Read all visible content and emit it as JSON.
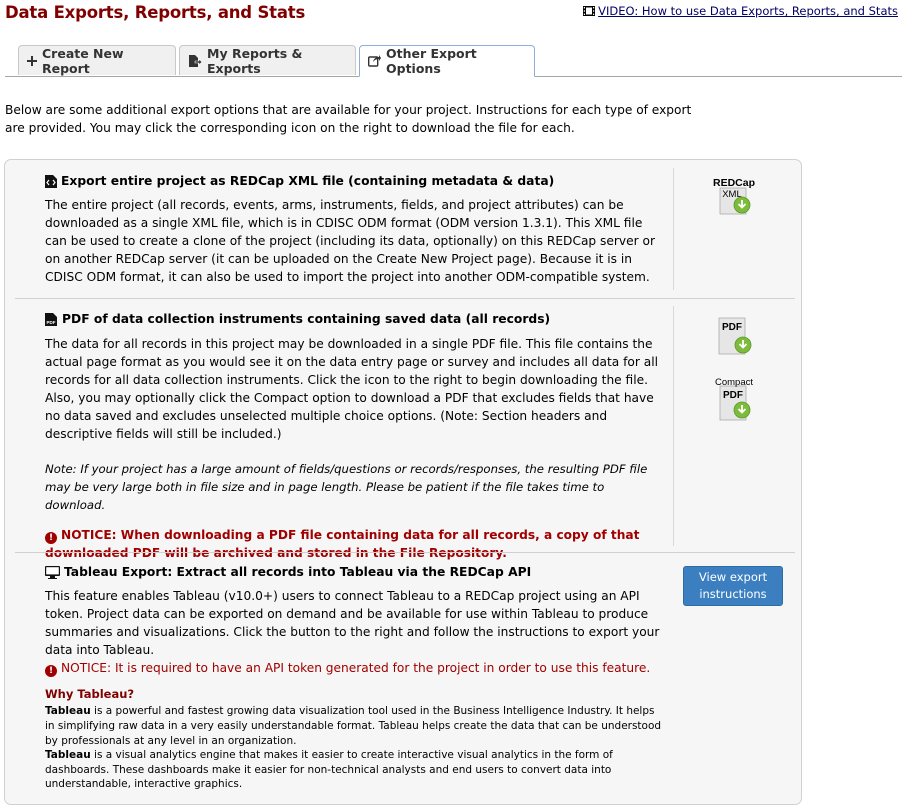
{
  "header": {
    "title": "Data Exports, Reports, and Stats",
    "video_link": "VIDEO: How to use Data Exports, Reports, and Stats"
  },
  "tabs": [
    {
      "label": "Create New Report",
      "icon": "plus-icon"
    },
    {
      "label": "My Reports & Exports",
      "icon": "export-icon"
    },
    {
      "label": "Other Export Options",
      "icon": "share-icon",
      "active": true
    }
  ],
  "intro": {
    "line1": "Below are some additional export options that are available for your project. Instructions for each type of export",
    "line2": "are provided. You may click the corresponding icon on the right to download the file for each."
  },
  "sections": {
    "xml": {
      "title": "Export entire project as REDCap XML file (containing metadata & data)",
      "body": "The entire project (all records, events, arms, instruments, fields, and project attributes) can be downloaded as a single XML file, which is in CDISC ODM format (ODM version 1.3.1). This XML file can be used to create a clone of the project (including its data, optionally) on this REDCap server or on another REDCap server (it can be uploaded on the Create New Project page). Because it is in CDISC ODM format, it can also be used to import the project into another ODM-compatible system.",
      "icon_label_top": "REDCap",
      "icon_label_bottom": "XML"
    },
    "pdf": {
      "title": "PDF of data collection instruments containing saved data (all records)",
      "body": "The data for all records in this project may be downloaded in a single PDF file. This file contains the actual page format as you would see it on the data entry page or survey and includes all data for all records for all data collection instruments. Click the icon to the right to begin downloading the file. Also, you may optionally click the Compact option to download a PDF that excludes fields that have no data saved and excludes unselected multiple choice options. (Note: Section headers and descriptive fields will still be included.)",
      "note": "Note: If your project has a large amount of fields/questions or records/responses, the resulting PDF file may be very large both in file size and in page length. Please be patient if the file takes time to download.",
      "notice": "NOTICE: When downloading a PDF file containing data for all records, a copy of that downloaded PDF will be archived and stored in the File Repository.",
      "icon_pdf_label": "PDF",
      "icon_compact_label": "Compact",
      "icon_compact_pdf_label": "PDF"
    },
    "tableau": {
      "title": "Tableau Export: Extract all records into Tableau via the REDCap API",
      "body": "This feature enables Tableau (v10.0+) users to connect Tableau to a REDCap project using an API token. Project data can be exported on demand and be available for use within Tableau to produce summaries and visualizations. Click the button to the right and follow the instructions to export your data into Tableau.",
      "notice": "NOTICE: It is required to have an API token generated for the project in order to use this feature.",
      "button": "View export instructions",
      "why_title": "Why Tableau?",
      "why_1_bold": "Tableau",
      "why_1_text": " is a powerful and fastest growing data visualization tool used in the Business Intelligence Industry. It helps in simplifying raw data in a very easily understandable format. Tableau helps create the data that can be understood by professionals at any level in an organization.",
      "why_2_bold": "Tableau",
      "why_2_text": " is a visual analytics engine that makes it easier to create interactive visual analytics in the form of dashboards. These dashboards make it easier for non-technical analysts and end users to convert data into understandable, interactive graphics."
    }
  },
  "colors": {
    "title": "#800000",
    "notice": "#a00000",
    "button": "#3c7fc1",
    "download_arrow": "#7dbb3c"
  }
}
